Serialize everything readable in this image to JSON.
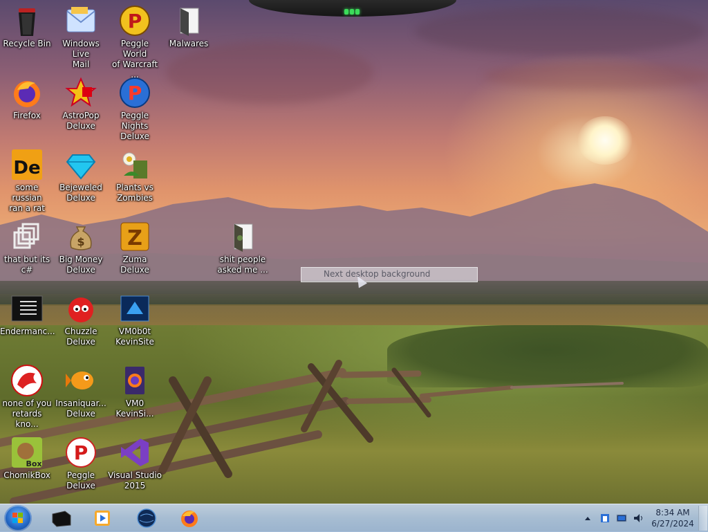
{
  "desktop": {
    "icons": [
      {
        "label": "Recycle Bin",
        "icon": "recycle-bin-icon"
      },
      {
        "label": "Windows Live\nMail",
        "icon": "mail-icon"
      },
      {
        "label": "Peggle World\nof Warcraft ...",
        "icon": "peggle-icon"
      },
      {
        "label": "Malwares",
        "icon": "folder-icon"
      },
      {
        "label": "Firefox",
        "icon": "firefox-icon"
      },
      {
        "label": "AstroPop\nDeluxe",
        "icon": "astropop-icon"
      },
      {
        "label": "Peggle Nights\nDeluxe",
        "icon": "peggle-nights-icon"
      },
      {
        "label": "some russian\nran a rat",
        "icon": "de-icon"
      },
      {
        "label": "Bejeweled\nDeluxe",
        "icon": "gem-icon"
      },
      {
        "label": "Plants vs\nZombies",
        "icon": "plant-icon"
      },
      {
        "label": "that but its c#",
        "icon": "generic-app-icon"
      },
      {
        "label": "Big Money\nDeluxe",
        "icon": "money-bag-icon"
      },
      {
        "label": "Zuma Deluxe",
        "icon": "zuma-icon"
      },
      {
        "label": "shit people\nasked me ...",
        "icon": "folder-icon"
      },
      {
        "label": "Endermanc...",
        "icon": "console-icon"
      },
      {
        "label": "Chuzzle\nDeluxe",
        "icon": "chuzzle-icon"
      },
      {
        "label": "VM0b0t\nKevinSite",
        "icon": "vm-icon"
      },
      {
        "label": "none of you\nretards kno...",
        "icon": "dragon-icon"
      },
      {
        "label": "Insaniquar...\nDeluxe",
        "icon": "fish-icon"
      },
      {
        "label": "VM0\nKevinSi...",
        "icon": "firefox-doc-icon"
      },
      {
        "label": "ChomikBox",
        "icon": "chomikbox-icon"
      },
      {
        "label": "Peggle Deluxe",
        "icon": "peggle-icon"
      },
      {
        "label": "Visual Studio\n2015",
        "icon": "visual-studio-icon"
      }
    ],
    "context_popup": {
      "text": "Next desktop background"
    }
  },
  "taskbar": {
    "apps": [
      {
        "name": "black-app-icon"
      },
      {
        "name": "media-player-icon"
      },
      {
        "name": "globe-icon"
      },
      {
        "name": "firefox-icon"
      }
    ],
    "clock": {
      "time": "8:34 AM",
      "date": "6/27/2024"
    }
  }
}
